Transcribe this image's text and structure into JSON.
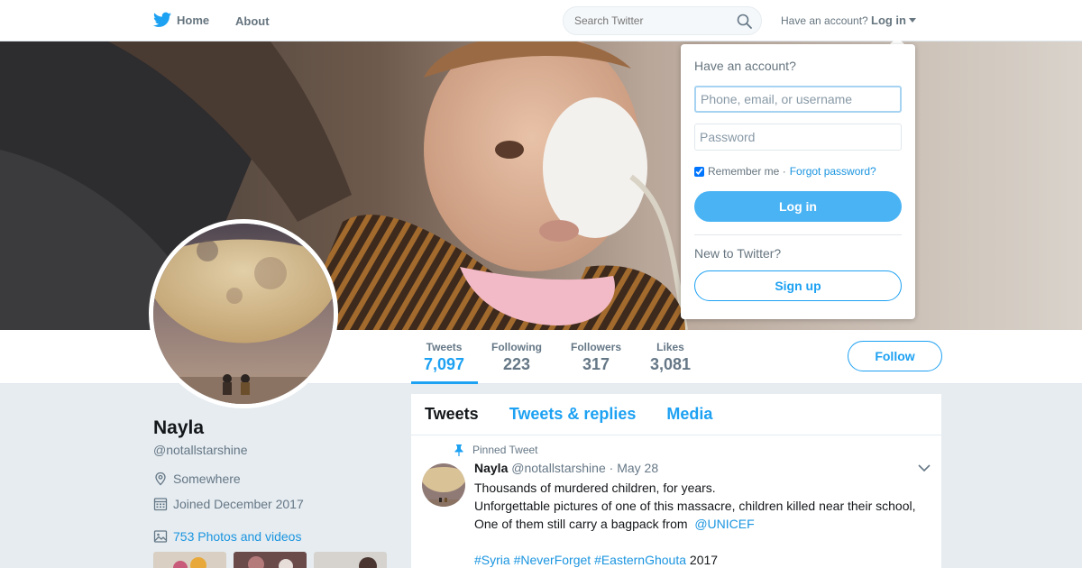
{
  "nav": {
    "home_label": "Home",
    "about_label": "About",
    "search_placeholder": "Search Twitter",
    "have_account_text": "Have an account?",
    "login_label": "Log in"
  },
  "profile": {
    "name": "Nayla",
    "handle": "@notallstarshine",
    "location": "Somewhere",
    "joined": "Joined December 2017",
    "photos_label": "753 Photos and videos"
  },
  "stats": [
    {
      "label": "Tweets",
      "value": "7,097"
    },
    {
      "label": "Following",
      "value": "223"
    },
    {
      "label": "Followers",
      "value": "317"
    },
    {
      "label": "Likes",
      "value": "3,081"
    }
  ],
  "follow_label": "Follow",
  "timeline": {
    "tabs": [
      "Tweets",
      "Tweets & replies",
      "Media"
    ],
    "pinned_label": "Pinned Tweet",
    "tweet": {
      "name": "Nayla",
      "handle": "@notallstarshine",
      "date": "· May 28",
      "line1": "Thousands of murdered children, for years.",
      "line2": "Unforgettable pictures of one of this massacre, children killed near their school,",
      "line3_text": "One of them still carry a bagpack from",
      "line3_mention": "@UNICEF",
      "hashtag1": "#Syria",
      "hashtag2": "#NeverForget",
      "hashtag3": "#EasternGhouta",
      "year": "2017"
    }
  },
  "login_dropdown": {
    "title": "Have an account?",
    "username_placeholder": "Phone, email, or username",
    "password_placeholder": "Password",
    "remember_label": "Remember me ·",
    "forgot_label": "Forgot password?",
    "login_button": "Log in",
    "new_label": "New to Twitter?",
    "signup_button": "Sign up"
  },
  "colors": {
    "accent": "#1da1f2",
    "link": "#1b95e0",
    "login_button_bg": "#4ab3f4",
    "page_bg": "#e6ecf0"
  }
}
